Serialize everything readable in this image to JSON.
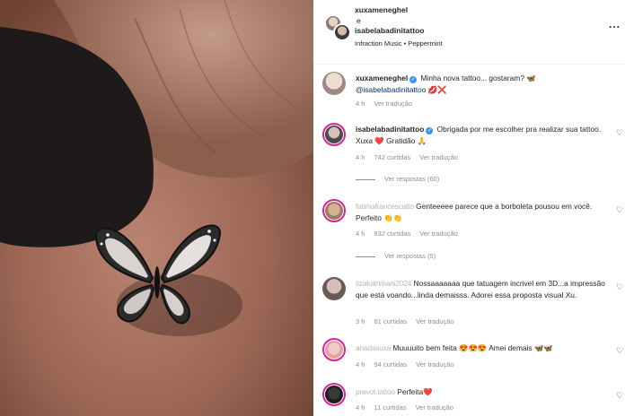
{
  "post": {
    "photo_alt": "butterfly-tattoo-photo"
  },
  "header": {
    "user1": "xuxameneghel",
    "and_text": "e",
    "user2": "isabelabadinitattoo",
    "music": "Infraction Music • Peppermint",
    "more": "..."
  },
  "comments": [
    {
      "user": "xuxameneghel",
      "text": "Minha nova tattoo... gostaram? 🦋",
      "mention": "@isabelabadinitattoo",
      "trail": "💋❌",
      "time": "4 h",
      "see_translation": "Ver tradução"
    },
    {
      "user": "isabelabadinitattoo",
      "text": "Obrigada por me escolher pra realizar sua tattoo. Xuxa ❤️ Gratidão 🙏",
      "time": "4 h",
      "likes": "742 curtidas",
      "see_translation": "Ver tradução",
      "replies": "Ver respostas (60)"
    },
    {
      "user": "fatimafrancescatto",
      "text": "Genteeeee parece que a borboleta pousou em você. Perfeito 👏👏",
      "time": "4 h",
      "likes": "632 curtidas",
      "see_translation": "Ver tradução",
      "replies": "Ver respostas (5)"
    },
    {
      "user": "tizakatrimani2024",
      "text": "Nossaaaaaaa que tatuagem incrivel em 3D...a impressão que está voando...linda demaisss. Adorei essa proposta visual Xu.",
      "time": "3 h",
      "likes": "81 curtidas",
      "see_translation": "Ver tradução"
    },
    {
      "user": "anadaxuxa",
      "text": "Muuuuito bem feita 😍😍😍 Amei demais 🦋🦋",
      "time": "4 h",
      "likes": "94 curtidas",
      "see_translation": "Ver tradução"
    },
    {
      "user": "prevot.tattoo",
      "text": "Perfeita❤️",
      "time": "4 h",
      "likes": "11 curtidas",
      "see_translation": "Ver tradução"
    }
  ],
  "icons": {
    "verified": "✓",
    "like": "♡"
  },
  "colors": {
    "text": "#262626",
    "meta": "#8e8e8e",
    "verified": "#3897f0",
    "mention": "#00376b",
    "story_ring": "#d6249f"
  }
}
